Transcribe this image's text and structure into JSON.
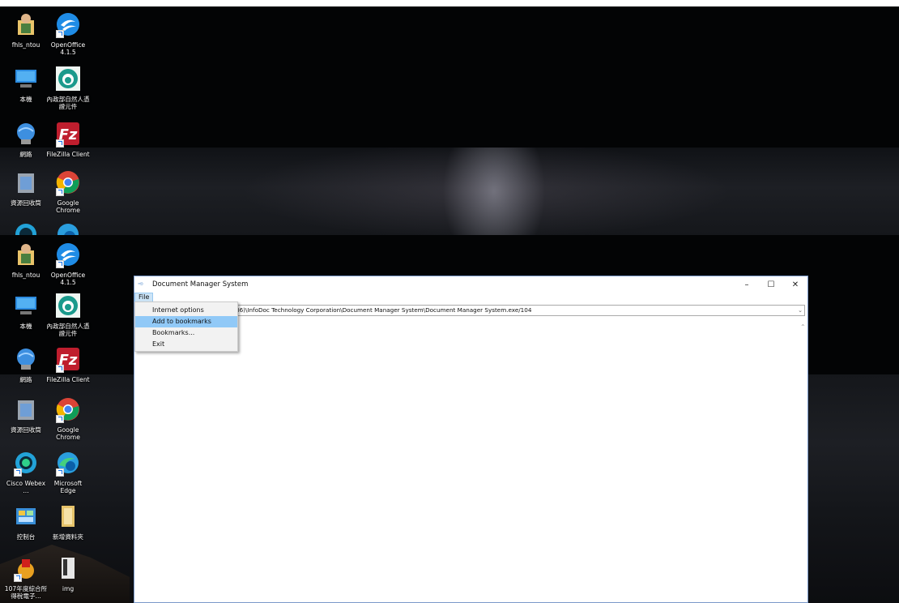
{
  "desktop": {
    "icons": [
      {
        "label": "fhls_ntou",
        "icon": "user-folder-icon",
        "color": "#f0c060"
      },
      {
        "label": "OpenOffice 4.1.5",
        "icon": "openoffice-icon",
        "color": "#1f8ce6"
      },
      {
        "label": "本機",
        "icon": "computer-icon",
        "color": "#2c8be0"
      },
      {
        "label": "內政部自然人憑證元件",
        "icon": "moica-icon",
        "color": "#1a9a8c"
      },
      {
        "label": "網路",
        "icon": "network-icon",
        "color": "#3d8fe0"
      },
      {
        "label": "FileZilla Client",
        "icon": "filezilla-icon",
        "color": "#bf1e2e"
      },
      {
        "label": "資源回收筒",
        "icon": "recycle-bin-icon",
        "color": "#9aa4b0"
      },
      {
        "label": "Google Chrome",
        "icon": "chrome-icon",
        "color": "#e8a33d"
      },
      {
        "label": "Cisco Webex ...",
        "icon": "webex-icon",
        "color": "#22a2d8"
      },
      {
        "label": "Microsoft Edge",
        "icon": "edge-icon",
        "color": "#2a9ede"
      },
      {
        "label": "控制台",
        "icon": "control-panel-icon",
        "color": "#3a8fd8"
      },
      {
        "label": "新增資料夾",
        "icon": "folder-icon",
        "color": "#e6c36a"
      },
      {
        "label": "107年度綜合所得稅電子...",
        "icon": "tax-icon",
        "color": "#e8a020"
      },
      {
        "label": "img",
        "icon": "file-icon",
        "color": "#e6e6e6"
      }
    ]
  },
  "window": {
    "title": "Document Manager System",
    "title_icon": "app-icon",
    "controls": {
      "minimize": "–",
      "maximize": "☐",
      "close": "✕"
    },
    "menu": {
      "file": "File"
    },
    "address": "86)\\InfoDoc Technology Corporation\\Document Manager System\\Document Manager System.exe/104",
    "dropdown_arrow": "⌄",
    "scroll_up": "⌃"
  },
  "file_menu": {
    "items": [
      {
        "label": "Internet options",
        "selected": false
      },
      {
        "label": "Add to bookmarks",
        "selected": true
      },
      {
        "label": "Bookmarks...",
        "selected": false
      },
      {
        "label": "Exit",
        "selected": false
      }
    ]
  },
  "colors": {
    "menu_highlight": "#91c9f7",
    "window_border": "#7a99c9"
  }
}
